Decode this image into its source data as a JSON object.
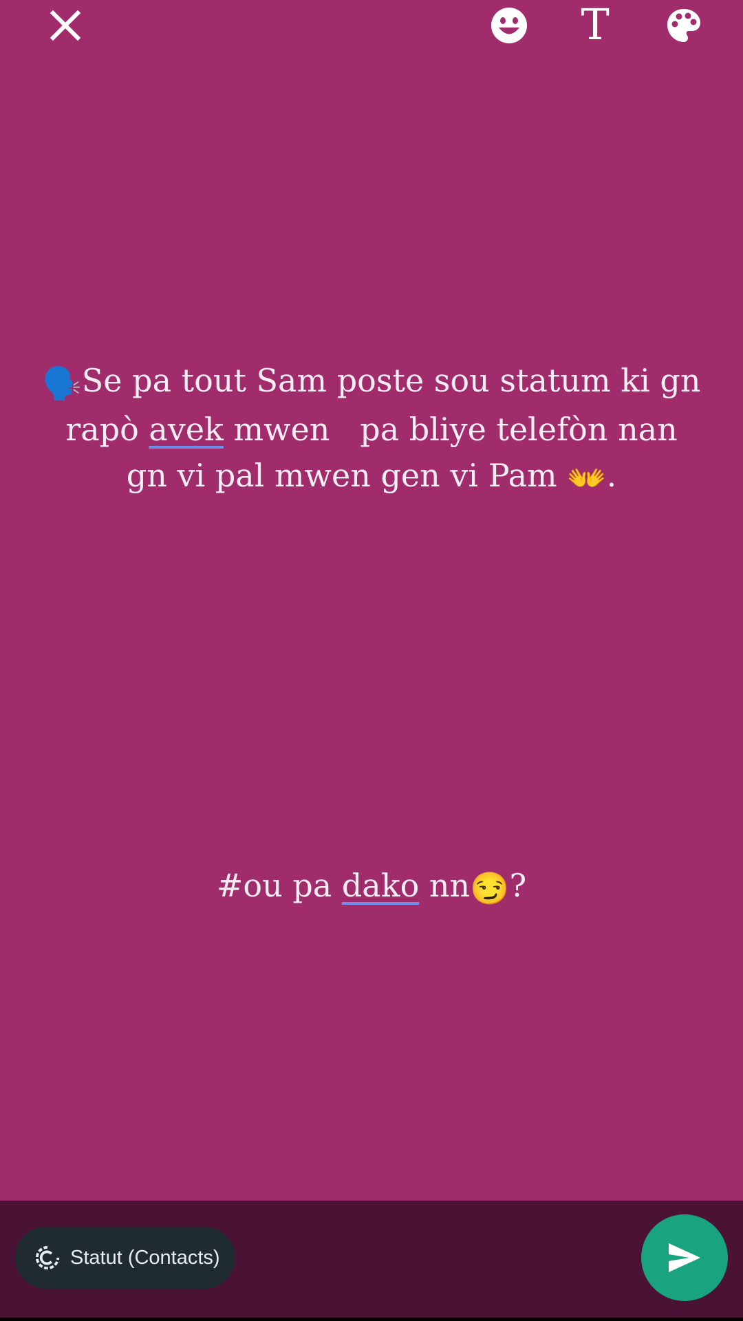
{
  "toolbar": {
    "close_icon": "close-icon",
    "emoji_icon": "smiley-icon",
    "text_icon": "text-style-icon",
    "text_glyph": "T",
    "palette_icon": "palette-icon"
  },
  "status": {
    "line1_emoji": "🗣️",
    "line1_text": "Se pa tout Sam poste sou statum ki gn",
    "line2_before": "rapò ",
    "line2_underlined": "avek",
    "line2_after": " mwen   pa bliye telefòn nan",
    "line3_text": "gn vi pal mwen gen vi Pam ",
    "line3_emoji": "👐",
    "line3_end": ".",
    "hashtag_before": "#ou pa ",
    "hashtag_underlined": "dako",
    "hashtag_after": " nn",
    "hashtag_emoji": "😏",
    "hashtag_end": "?"
  },
  "footer": {
    "audience_label": "Statut (Contacts)",
    "send_icon": "send-icon"
  },
  "colors": {
    "background": "#a12c6c",
    "footer_bar": "#4a1235",
    "chip": "#1f2b31",
    "send_button": "#1aa37f",
    "spellcheck_underline": "#6f8fe8"
  }
}
